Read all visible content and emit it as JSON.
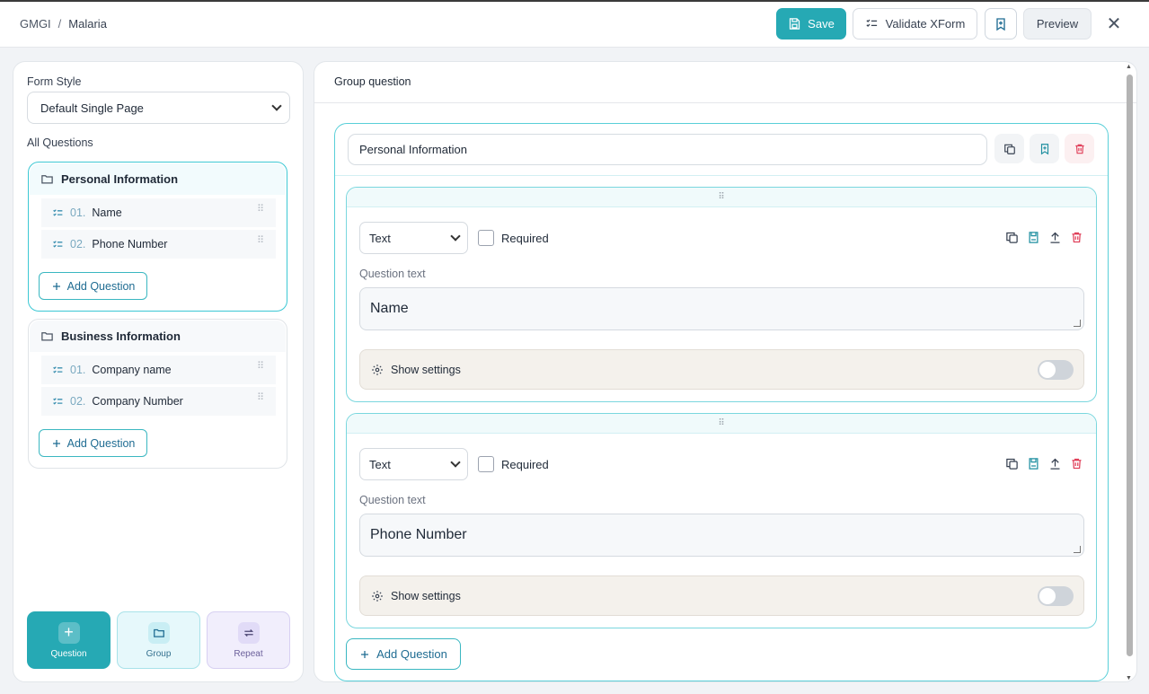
{
  "breadcrumb": {
    "root": "GMGI",
    "separator": "/",
    "current": "Malaria"
  },
  "header": {
    "save_label": "Save",
    "validate_label": "Validate XForm",
    "preview_label": "Preview",
    "close_symbol": "✕"
  },
  "sidebar": {
    "form_style_label": "Form Style",
    "form_style_value": "Default Single Page",
    "all_questions_label": "All Questions",
    "groups": [
      {
        "title": "Personal Information",
        "active": true,
        "items": [
          {
            "num": "01.",
            "label": "Name"
          },
          {
            "num": "02.",
            "label": "Phone Number"
          }
        ],
        "add_label": "Add Question"
      },
      {
        "title": "Business Information",
        "active": false,
        "items": [
          {
            "num": "01.",
            "label": "Company name"
          },
          {
            "num": "02.",
            "label": "Company Number"
          }
        ],
        "add_label": "Add Question"
      }
    ],
    "tiles": {
      "question": "Question",
      "group": "Group",
      "repeat": "Repeat"
    }
  },
  "main": {
    "title": "Group question",
    "group_name": "Personal Information",
    "questions": [
      {
        "type": "Text",
        "required_label": "Required",
        "question_text_label": "Question text",
        "question_text": "Name",
        "settings_label": "Show settings"
      },
      {
        "type": "Text",
        "required_label": "Required",
        "question_text_label": "Question text",
        "question_text": "Phone Number",
        "settings_label": "Show settings"
      }
    ],
    "add_label": "Add Question"
  },
  "colors": {
    "accent": "#26a9b4",
    "accent_border": "#59cfd8",
    "danger": "#e0405a",
    "link": "#1f6c92"
  }
}
